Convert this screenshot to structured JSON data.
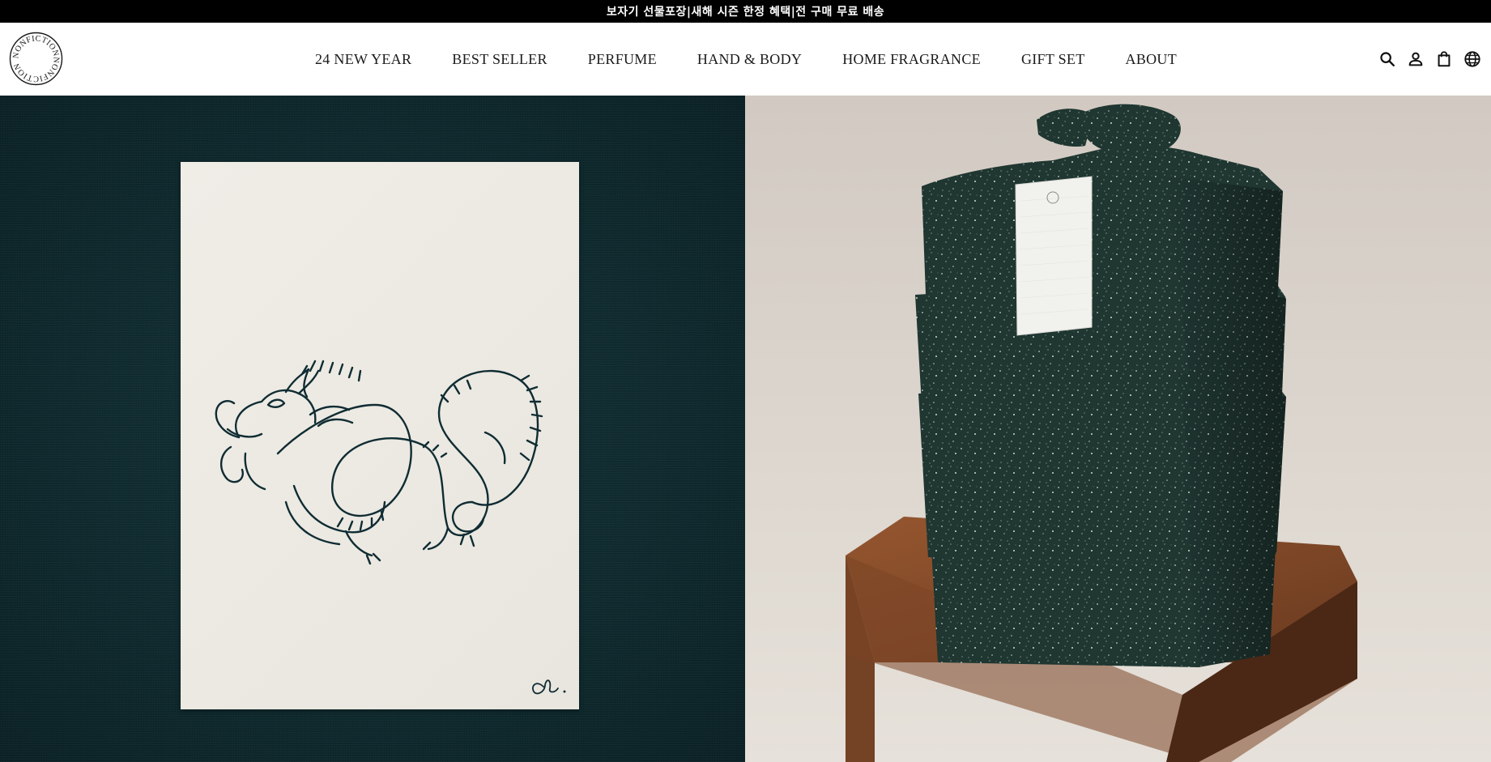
{
  "announcement": {
    "text": "보자기 선물포장|새해 시즌 한정 혜택|전 구매 무료 배송"
  },
  "brand": {
    "logo_text": "NONFICTIONNONFICTION",
    "logo_icon": "nonfiction-logo"
  },
  "nav": {
    "items": [
      {
        "label": "24 NEW YEAR"
      },
      {
        "label": "BEST SELLER"
      },
      {
        "label": "PERFUME"
      },
      {
        "label": "HAND & BODY"
      },
      {
        "label": "HOME FRAGRANCE"
      },
      {
        "label": "GIFT SET"
      },
      {
        "label": "ABOUT"
      }
    ]
  },
  "header_icons": [
    {
      "icon": "search-icon"
    },
    {
      "icon": "account-icon"
    },
    {
      "icon": "cart-icon"
    },
    {
      "icon": "globe-icon"
    }
  ],
  "colors": {
    "announcement_bg": "#000000",
    "nav_text": "#1a1a1a",
    "hero_left_bg": "#0f2a2e",
    "hero_right_bg": "#d8d1c9",
    "card_bg": "#ecebe4",
    "ink": "#102c33",
    "wrap_cloth": "#1e3530",
    "wood": "#7a4528"
  },
  "hero": {
    "left_image": "dragon-illustration-card",
    "right_image": "bojagi-wrapped-gift-boxes"
  }
}
